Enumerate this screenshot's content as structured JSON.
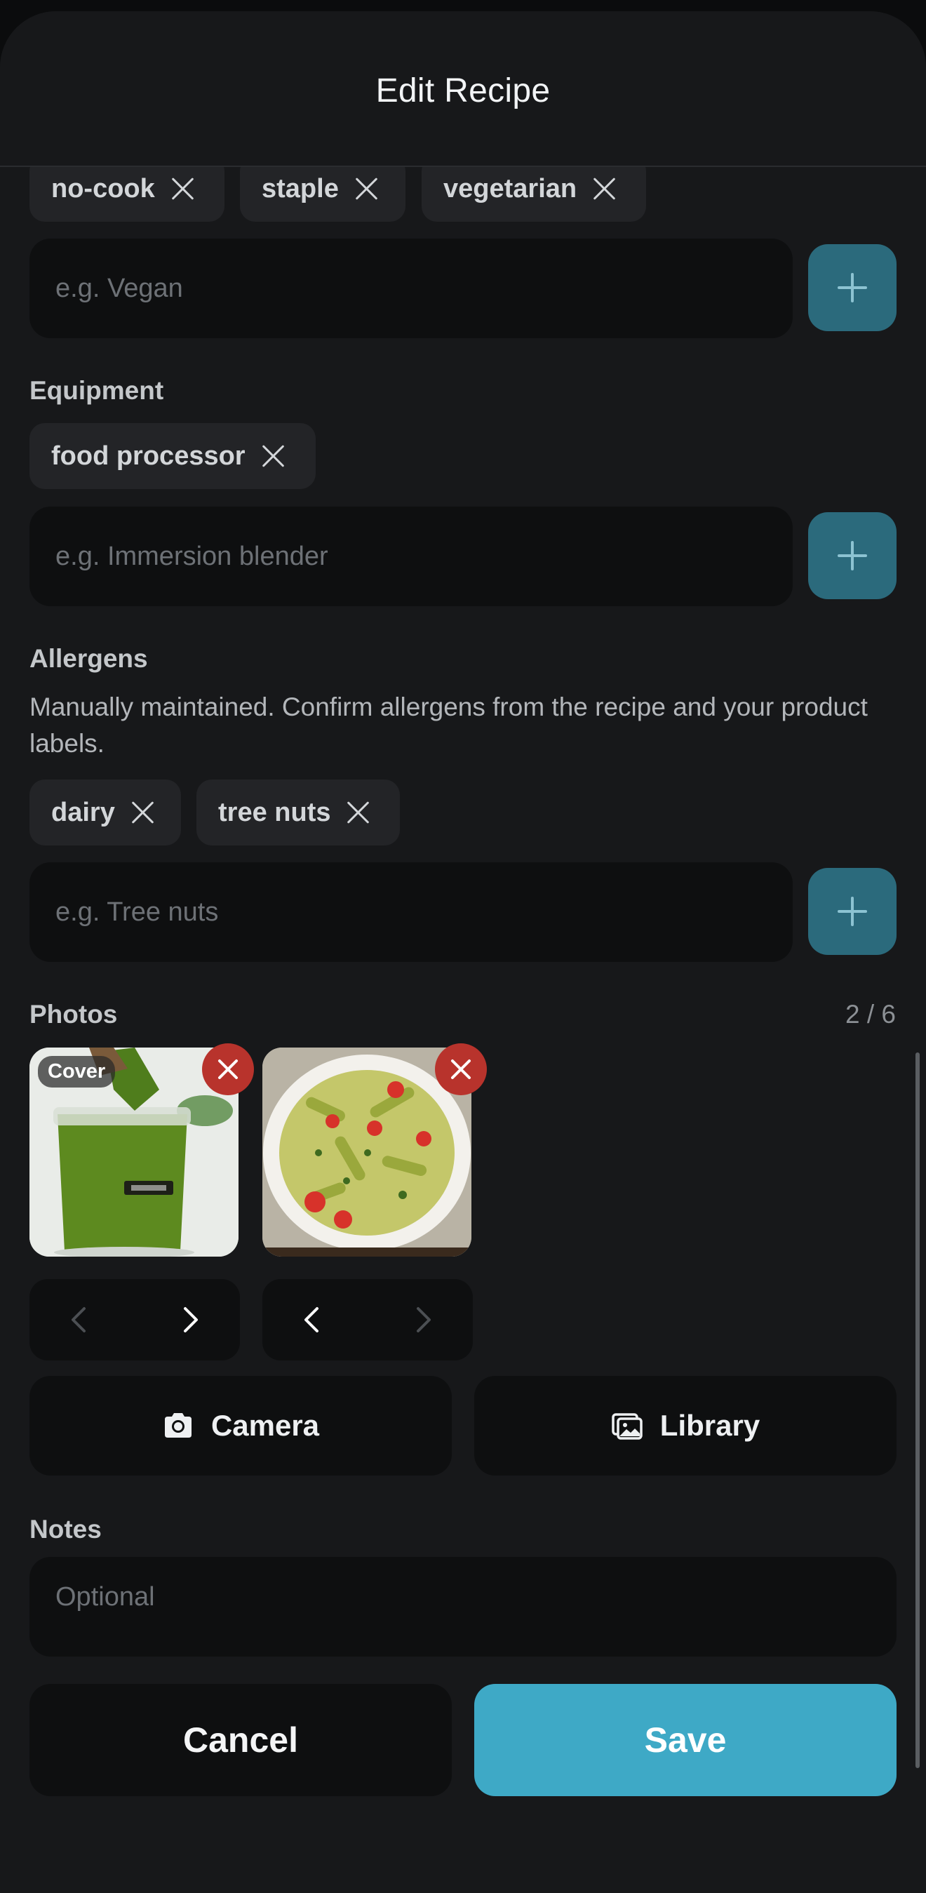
{
  "header": {
    "title": "Edit Recipe"
  },
  "tags": {
    "items": [
      "no-cook",
      "staple",
      "vegetarian"
    ],
    "placeholder": "e.g. Vegan"
  },
  "equipment": {
    "label": "Equipment",
    "items": [
      "food processor"
    ],
    "placeholder": "e.g. Immersion blender"
  },
  "allergens": {
    "label": "Allergens",
    "help": "Manually maintained. Confirm allergens from the recipe and your product labels.",
    "items": [
      "dairy",
      "tree nuts"
    ],
    "placeholder": "e.g. Tree nuts"
  },
  "photos": {
    "label": "Photos",
    "count": "2 / 6",
    "cover_label": "Cover",
    "camera_label": "Camera",
    "library_label": "Library"
  },
  "notes": {
    "label": "Notes",
    "placeholder": "Optional"
  },
  "footer": {
    "cancel_label": "Cancel",
    "save_label": "Save"
  },
  "colors": {
    "accent": "#3ea9c6",
    "add_button": "#2b6a7c",
    "remove": "#b8332c",
    "background": "#17181a"
  },
  "icons": [
    "plus-icon",
    "close-icon",
    "camera-icon",
    "gallery-icon",
    "chevron-left-icon",
    "chevron-right-icon"
  ]
}
